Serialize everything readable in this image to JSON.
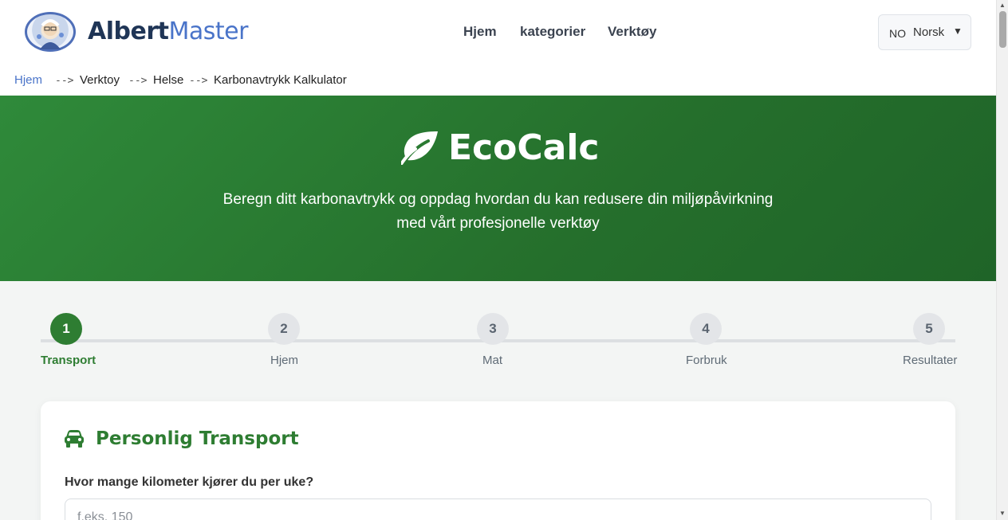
{
  "header": {
    "brand_part1": "Albert",
    "brand_part2": "Master",
    "nav": [
      "Hjem",
      "kategorier",
      "Verktøy"
    ],
    "language": {
      "code": "NO",
      "name": "Norsk"
    }
  },
  "breadcrumb": {
    "items": [
      "Hjem",
      "Verktoy",
      "Helse",
      "Karbonavtrykk Kalkulator"
    ],
    "separator": "-->"
  },
  "hero": {
    "title": "EcoCalc",
    "subtitle_line1": "Beregn ditt karbonavtrykk og oppdag hvordan du kan redusere din miljøpåvirkning",
    "subtitle_line2": "med vårt profesjonelle verktøy",
    "icon": "leaf-icon"
  },
  "steps": [
    {
      "number": "1",
      "label": "Transport",
      "active": true
    },
    {
      "number": "2",
      "label": "Hjem",
      "active": false
    },
    {
      "number": "3",
      "label": "Mat",
      "active": false
    },
    {
      "number": "4",
      "label": "Forbruk",
      "active": false
    },
    {
      "number": "5",
      "label": "Resultater",
      "active": false
    }
  ],
  "transport_card": {
    "icon": "car-icon",
    "title": "Personlig Transport",
    "question": "Hvor mange kilometer kjører du per uke?",
    "input_placeholder": "f.eks. 150",
    "input_value": ""
  },
  "colors": {
    "accent_green": "#2e7d32",
    "brand_blue": "#4a74c9",
    "brand_navy": "#1f3556"
  }
}
